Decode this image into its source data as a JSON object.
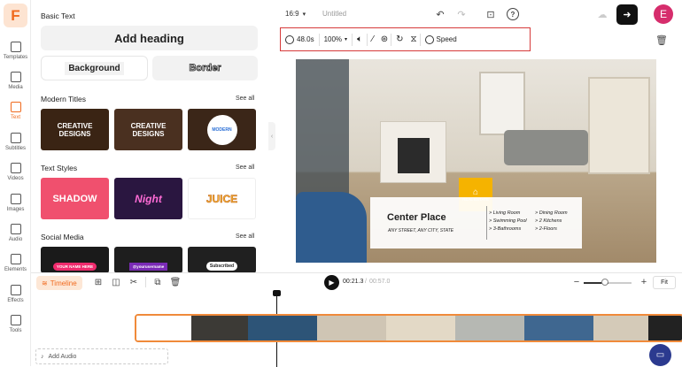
{
  "app": {
    "logo": "F",
    "canvas_ratio": "16:9",
    "doc_title": "Untitled",
    "avatar": "E"
  },
  "rail": [
    "Templates",
    "Media",
    "Text",
    "Subtitles",
    "Videos",
    "Images",
    "Audio",
    "Elements",
    "Effects",
    "Tools"
  ],
  "panel": {
    "basic_text": "Basic Text",
    "add_heading": "Add heading",
    "background": "Background",
    "border": "Border",
    "modern_titles": "Modern Titles",
    "text_styles": "Text Styles",
    "social_media": "Social Media",
    "see_all": "See all",
    "modern_cards": [
      "CREATIVE DESIGNS",
      "CREATIVE DESIGNS",
      "MODERN"
    ],
    "style_cards": [
      "SHADOW",
      "Night",
      "JUICE"
    ],
    "social_cards": [
      "YOUR NAME HERE",
      "@yourusername",
      "Subscribed"
    ]
  },
  "toolbar": {
    "duration": "48.0s",
    "zoom": "100%",
    "speed": "Speed"
  },
  "canvas": {
    "title": "Center Place",
    "address": "ANY STREET, ANY CITY, STATE",
    "badge": "REAL ESTATE",
    "features_left": [
      "> Living Room",
      "> Swimming Pool",
      "> 3-Bathrooms"
    ],
    "features_right": [
      "> Dining Room",
      "> 2 Kitchens",
      "> 2-Floors"
    ]
  },
  "timeline": {
    "label": "Timeline",
    "current": "00:21.3",
    "total": "00:57.0",
    "fit": "Fit",
    "add_audio": "Add Audio"
  },
  "colors": {
    "accent": "#f06a1e",
    "highlight": "#d63a3a"
  }
}
